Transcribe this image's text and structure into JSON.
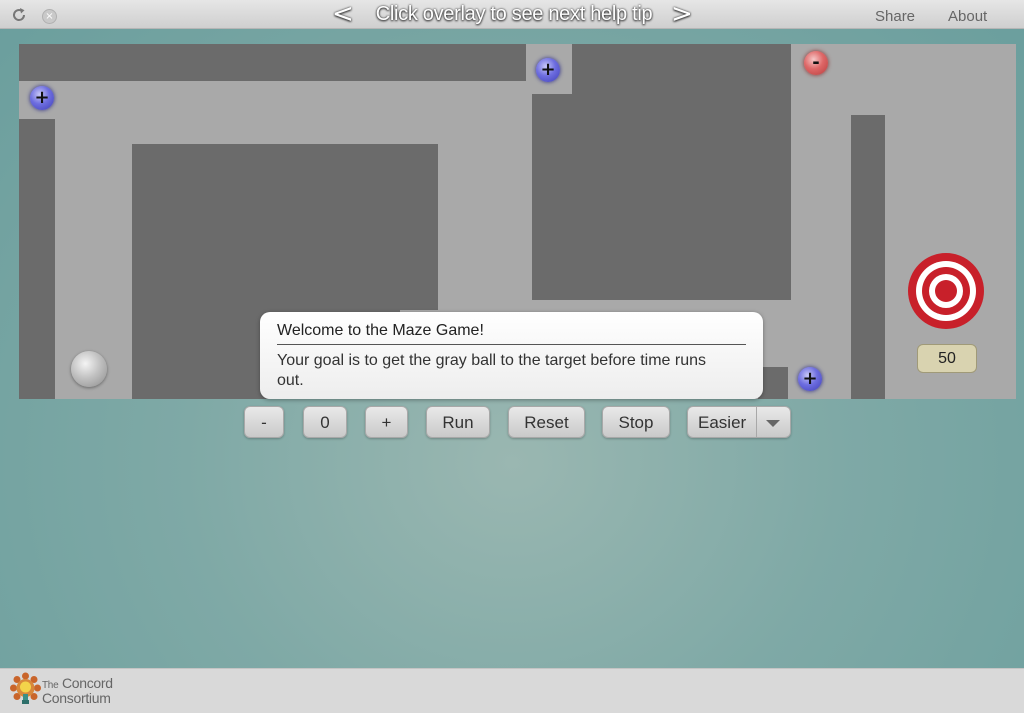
{
  "topbar": {
    "help_prev": "<",
    "help_text": "Click overlay to see next help tip",
    "help_next": ">",
    "close_glyph": "×",
    "share": "Share",
    "about": "About"
  },
  "maze": {
    "plus_glyph": "+",
    "minus_glyph": "-",
    "timer": "50"
  },
  "tooltip": {
    "title": "Welcome to the Maze Game!",
    "body": "Your goal is to get the gray ball to the target before time runs out."
  },
  "controls": {
    "minus": "-",
    "value": "0",
    "plus": "+",
    "run": "Run",
    "reset": "Reset",
    "stop": "Stop",
    "difficulty": "Easier"
  },
  "footer": {
    "logo_the": "The",
    "logo_concord": "Concord",
    "logo_consortium": "Consortium"
  },
  "colors": {
    "wall": "#6b6b6b",
    "floor": "#a9a9a9",
    "plus_button": "#5a5ad0",
    "minus_button": "#d05a5a",
    "target_red": "#c8202a",
    "background": "#7fa9a6"
  },
  "icons": [
    "reload-icon",
    "close-icon",
    "plus-icon",
    "minus-icon",
    "target-icon",
    "chevron-down-icon",
    "concord-logo-icon"
  ]
}
